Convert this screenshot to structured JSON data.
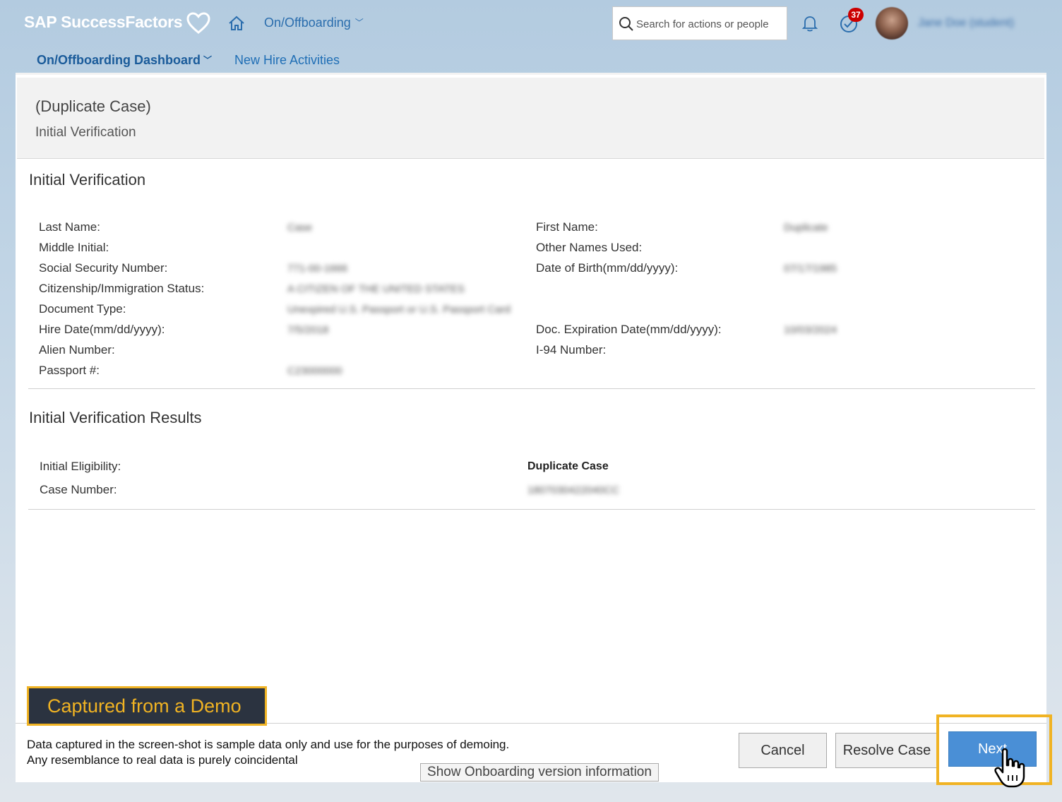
{
  "shell": {
    "logo": "SAP SuccessFactors",
    "module": "On/Offboarding",
    "search_placeholder": "Search for actions or people",
    "todo_count": "37",
    "user_name": "Jane Doe (student)"
  },
  "subnav": {
    "dashboard": "On/Offboarding Dashboard",
    "new_hire": "New Hire Activities"
  },
  "case_header": {
    "title": "(Duplicate Case)",
    "subtitle": "Initial Verification"
  },
  "verification": {
    "title": "Initial Verification",
    "left": [
      {
        "label": "Last Name:",
        "value": "Case"
      },
      {
        "label": "Middle Initial:",
        "value": ""
      },
      {
        "label": "Social Security Number:",
        "value": "771-00-1666"
      },
      {
        "label": "Citizenship/Immigration Status:",
        "value": "A CITIZEN OF THE UNITED STATES"
      },
      {
        "label": "Document Type:",
        "value": "Unexpired U.S. Passport or U.S. Passport Card"
      },
      {
        "label": "Hire Date(mm/dd/yyyy):",
        "value": "7/5/2018"
      },
      {
        "label": "Alien Number:",
        "value": ""
      },
      {
        "label": "Passport #:",
        "value": "C23000000"
      }
    ],
    "right": [
      {
        "label": "First Name:",
        "value": "Duplicate"
      },
      {
        "label": "Other Names Used:",
        "value": ""
      },
      {
        "label": "Date of Birth(mm/dd/yyyy):",
        "value": "07/17/1985"
      },
      {
        "label": "Doc. Expiration Date(mm/dd/yyyy):",
        "value": "10/03/2024"
      },
      {
        "label": "I-94 Number:",
        "value": ""
      }
    ]
  },
  "results": {
    "title": "Initial Verification Results",
    "eligibility_label": "Initial Eligibility:",
    "eligibility_value": "Duplicate Case",
    "case_number_label": "Case Number:",
    "case_number_value": "1807030422040CC"
  },
  "footer": {
    "demo_badge": "Captured from a Demo",
    "disclaimer_line1": "Data captured in the screen-shot is sample data only and use for the purposes of demoing.",
    "disclaimer_line2": "Any resemblance to real data is purely coincidental",
    "version_button": "Show Onboarding version information",
    "cancel": "Cancel",
    "resolve": "Resolve Case",
    "next": "Next"
  },
  "colors": {
    "accent": "#4a8fd6",
    "highlight": "#f0b323",
    "badge": "#cc0000"
  },
  "icons": [
    "heart-logo-icon",
    "home-icon",
    "search-icon",
    "bell-icon",
    "todo-check-icon",
    "hand-cursor-icon"
  ]
}
